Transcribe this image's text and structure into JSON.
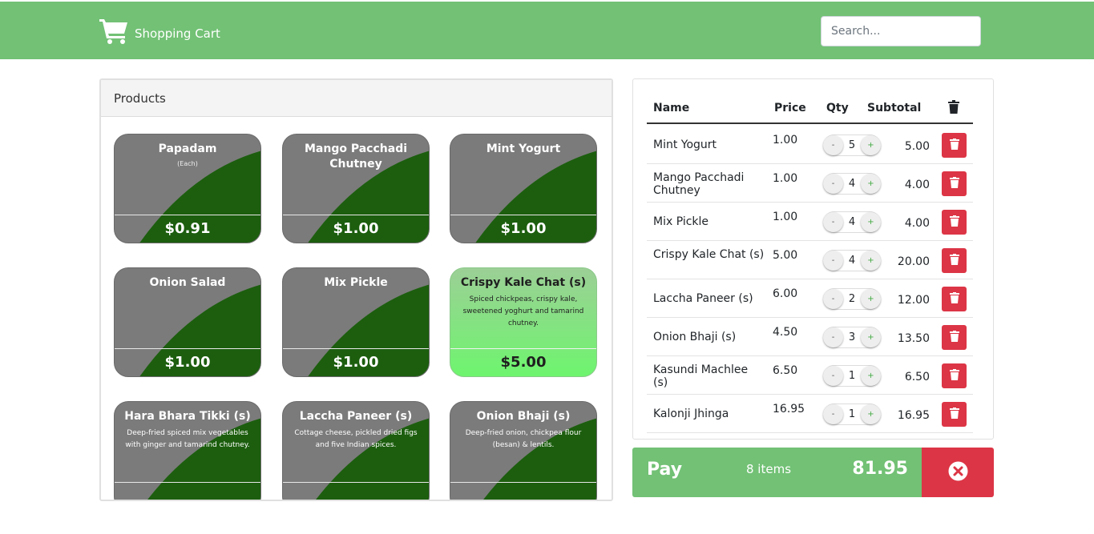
{
  "header": {
    "brand_icon": "cart-icon",
    "brand_label": "Shopping Cart",
    "search_placeholder": "Search..."
  },
  "products_panel": {
    "title": "Products",
    "cards": [
      {
        "name": "Papadam",
        "desc": "",
        "note": "(Each)",
        "price": "$0.91",
        "selected": false
      },
      {
        "name": "Mango Pacchadi Chutney",
        "desc": "",
        "note": "",
        "price": "$1.00",
        "selected": false
      },
      {
        "name": "Mint Yogurt",
        "desc": "",
        "note": "",
        "price": "$1.00",
        "selected": false
      },
      {
        "name": "Onion Salad",
        "desc": "",
        "note": "",
        "price": "$1.00",
        "selected": false
      },
      {
        "name": "Mix Pickle",
        "desc": "",
        "note": "",
        "price": "$1.00",
        "selected": false
      },
      {
        "name": "Crispy Kale Chat (s)",
        "desc": "Spiced chickpeas, crispy kale, sweetened yoghurt and tamarind chutney.",
        "note": "",
        "price": "$5.00",
        "selected": true
      },
      {
        "name": "Hara Bhara Tikki (s)",
        "desc": "Deep-fried spiced mix vegetables with ginger and tamarind chutney.",
        "note": "",
        "price": "",
        "selected": false
      },
      {
        "name": "Laccha Paneer (s)",
        "desc": "Cottage cheese, pickled dried figs and five Indian spices.",
        "note": "",
        "price": "",
        "selected": false
      },
      {
        "name": "Onion Bhaji (s)",
        "desc": "Deep-fried onion, chickpea flour (besan) & lentils.",
        "note": "",
        "price": "",
        "selected": false
      }
    ]
  },
  "cart": {
    "columns": {
      "name": "Name",
      "price": "Price",
      "qty": "Qty",
      "subtotal": "Subtotal",
      "delete_icon": "trash-icon"
    },
    "rows": [
      {
        "name": "Mint Yogurt",
        "price": "1.00",
        "qty": "5",
        "subtotal": "5.00"
      },
      {
        "name": "Mango Pacchadi Chutney",
        "price": "1.00",
        "qty": "4",
        "subtotal": "4.00"
      },
      {
        "name": "Mix Pickle",
        "price": "1.00",
        "qty": "4",
        "subtotal": "4.00"
      },
      {
        "name": "Crispy Kale Chat (s)",
        "price": "5.00",
        "qty": "4",
        "subtotal": "20.00"
      },
      {
        "name": "Laccha Paneer (s)",
        "price": "6.00",
        "qty": "2",
        "subtotal": "12.00"
      },
      {
        "name": "Onion Bhaji (s)",
        "price": "4.50",
        "qty": "3",
        "subtotal": "13.50"
      },
      {
        "name": "Kasundi Machlee (s)",
        "price": "6.50",
        "qty": "1",
        "subtotal": "6.50"
      },
      {
        "name": "Kalonji Jhinga",
        "price": "16.95",
        "qty": "1",
        "subtotal": "16.95"
      }
    ],
    "minus_label": "-",
    "plus_label": "+"
  },
  "pay_bar": {
    "label": "Pay",
    "items": "8 items",
    "total": "81.95",
    "cancel_icon": "close-circle-icon"
  },
  "colors": {
    "header_green": "#72c175",
    "card_gray": "#7b7b7b",
    "card_dark_green": "#1c5e0e",
    "danger_red": "#dc3545"
  }
}
